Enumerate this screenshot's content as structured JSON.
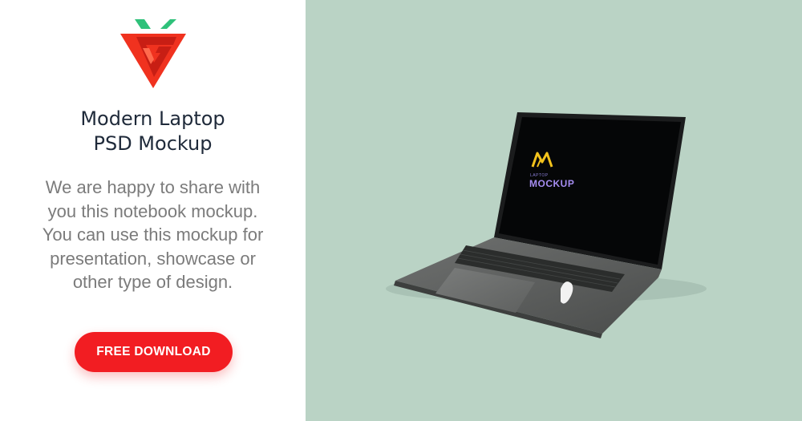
{
  "promo": {
    "title_line1": "Modern Laptop",
    "title_line2": "PSD Mockup",
    "description_lines": [
      "We are happy to share with",
      "you this notebook mockup.",
      "You can use this mockup for",
      "presentation, showcase or",
      "other type of design."
    ],
    "cta_label": "FREE DOWNLOAD"
  },
  "screen": {
    "kicker": "LAPTOP",
    "word": "MOCKUP"
  },
  "colors": {
    "accent": "#f21d22",
    "logo_leaf": "#2fc17a",
    "backdrop": "#bad3c5",
    "title_text": "#1f2a3a",
    "body_text": "#7b7b7b"
  }
}
